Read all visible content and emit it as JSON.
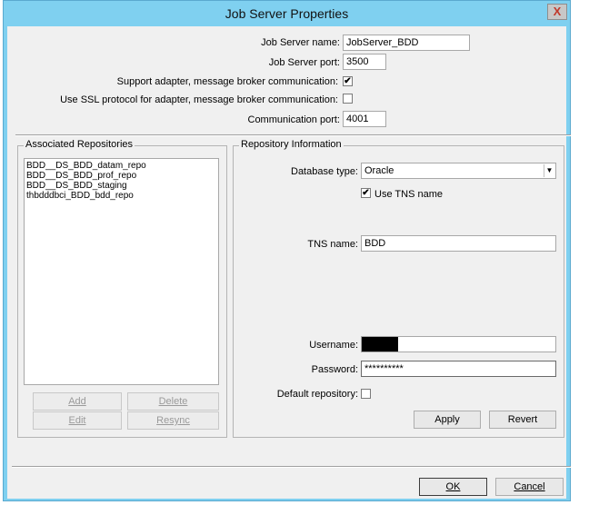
{
  "window": {
    "title": "Job Server Properties",
    "close_label": "X"
  },
  "server": {
    "name_label": "Job Server name:",
    "name_value": "JobServer_BDD",
    "port_label": "Job Server port:",
    "port_value": "3500",
    "adapter_label": "Support adapter, message broker communication:",
    "adapter_checked": "✔",
    "ssl_label": "Use SSL protocol for adapter, message broker communication:",
    "comm_port_label": "Communication port:",
    "comm_port_value": "4001"
  },
  "repos": {
    "legend": "Associated Repositories",
    "items": [
      "BDD__DS_BDD_datam_repo",
      "BDD__DS_BDD_prof_repo",
      "BDD__DS_BDD_staging",
      "thbdddbci_BDD_bdd_repo"
    ],
    "add_label": "Add",
    "delete_label": "Delete",
    "edit_label": "Edit",
    "resync_label": "Resync"
  },
  "info": {
    "legend": "Repository Information",
    "db_type_label": "Database type:",
    "db_type_value": "Oracle",
    "use_tns_label": "Use TNS name",
    "use_tns_checked": "✔",
    "tns_label": "TNS name:",
    "tns_value": "BDD",
    "username_label": "Username:",
    "password_label": "Password:",
    "password_value": "**********",
    "default_label": "Default repository:",
    "apply_label": "Apply",
    "revert_label": "Revert"
  },
  "footer": {
    "ok_label": "OK",
    "cancel_label": "Cancel"
  }
}
